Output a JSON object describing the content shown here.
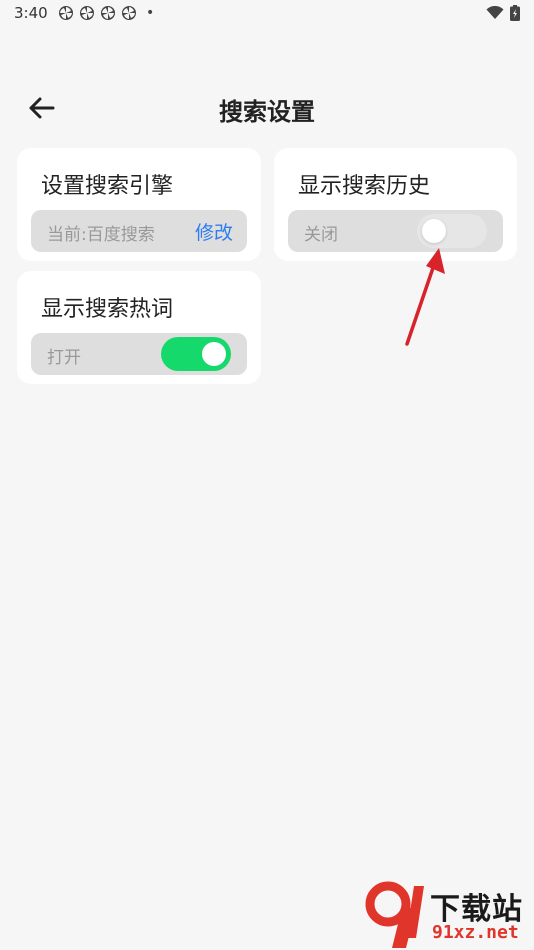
{
  "status_bar": {
    "time": "3:40",
    "dot": "•",
    "notification_icons": [
      "pinwheel-icon",
      "pinwheel-icon",
      "pinwheel-icon",
      "pinwheel-icon"
    ],
    "right_icons": [
      "wifi-icon",
      "battery-charging-icon"
    ]
  },
  "header": {
    "title": "搜索设置",
    "back_icon": "arrow-left-icon"
  },
  "cards": {
    "search_engine": {
      "title": "设置搜索引擎",
      "current_label": "当前:百度搜索",
      "edit_link": "修改"
    },
    "search_history": {
      "title": "显示搜索历史",
      "state_label": "关闭",
      "enabled": false
    },
    "hot_words": {
      "title": "显示搜索热词",
      "state_label": "打开",
      "enabled": true
    }
  },
  "watermark": {
    "text": "下载站",
    "sub": "91xz.net"
  },
  "colors": {
    "accent_green": "#16d96b",
    "link_blue": "#2d7df0",
    "arrow_red": "#d8232a",
    "background": "#f6f6f7"
  }
}
